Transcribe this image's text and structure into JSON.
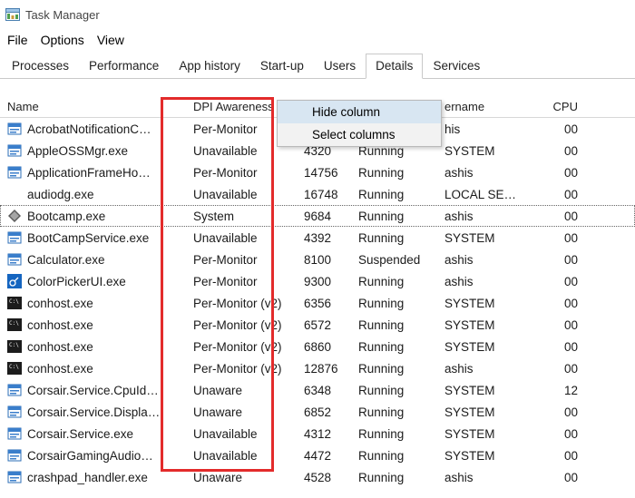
{
  "window": {
    "title": "Task Manager"
  },
  "menu": [
    "File",
    "Options",
    "View"
  ],
  "tabs": [
    "Processes",
    "Performance",
    "App history",
    "Start-up",
    "Users",
    "Details",
    "Services"
  ],
  "active_tab": 5,
  "columns": {
    "name": "Name",
    "dpi": "DPI Awareness",
    "pid": "",
    "status": "",
    "user": "ername",
    "cpu": "CPU"
  },
  "context_menu": {
    "items": [
      "Hide column",
      "Select columns"
    ]
  },
  "rows": [
    {
      "icon": "blue",
      "name": "AcrobatNotificationC…",
      "dpi": "Per-Monitor",
      "pid": "",
      "status": "",
      "user": "his",
      "cpu": "00"
    },
    {
      "icon": "blue",
      "name": "AppleOSSMgr.exe",
      "dpi": "Unavailable",
      "pid": "4320",
      "status": "Running",
      "user": "SYSTEM",
      "cpu": "00"
    },
    {
      "icon": "blue",
      "name": "ApplicationFrameHo…",
      "dpi": "Per-Monitor",
      "pid": "14756",
      "status": "Running",
      "user": "ashis",
      "cpu": "00"
    },
    {
      "icon": "none",
      "name": "audiodg.exe",
      "dpi": "Unavailable",
      "pid": "16748",
      "status": "Running",
      "user": "LOCAL SER…",
      "cpu": "00"
    },
    {
      "icon": "diamond",
      "name": "Bootcamp.exe",
      "dpi": "System",
      "pid": "9684",
      "status": "Running",
      "user": "ashis",
      "cpu": "00",
      "selected": true
    },
    {
      "icon": "blue",
      "name": "BootCampService.exe",
      "dpi": "Unavailable",
      "pid": "4392",
      "status": "Running",
      "user": "SYSTEM",
      "cpu": "00"
    },
    {
      "icon": "blue",
      "name": "Calculator.exe",
      "dpi": "Per-Monitor",
      "pid": "8100",
      "status": "Suspended",
      "user": "ashis",
      "cpu": "00"
    },
    {
      "icon": "picker",
      "name": "ColorPickerUI.exe",
      "dpi": "Per-Monitor",
      "pid": "9300",
      "status": "Running",
      "user": "ashis",
      "cpu": "00"
    },
    {
      "icon": "console",
      "name": "conhost.exe",
      "dpi": "Per-Monitor (v2)",
      "pid": "6356",
      "status": "Running",
      "user": "SYSTEM",
      "cpu": "00"
    },
    {
      "icon": "console",
      "name": "conhost.exe",
      "dpi": "Per-Monitor (v2)",
      "pid": "6572",
      "status": "Running",
      "user": "SYSTEM",
      "cpu": "00"
    },
    {
      "icon": "console",
      "name": "conhost.exe",
      "dpi": "Per-Monitor (v2)",
      "pid": "6860",
      "status": "Running",
      "user": "SYSTEM",
      "cpu": "00"
    },
    {
      "icon": "console",
      "name": "conhost.exe",
      "dpi": "Per-Monitor (v2)",
      "pid": "12876",
      "status": "Running",
      "user": "ashis",
      "cpu": "00"
    },
    {
      "icon": "blue",
      "name": "Corsair.Service.CpuId…",
      "dpi": "Unaware",
      "pid": "6348",
      "status": "Running",
      "user": "SYSTEM",
      "cpu": "12"
    },
    {
      "icon": "blue",
      "name": "Corsair.Service.Displa…",
      "dpi": "Unaware",
      "pid": "6852",
      "status": "Running",
      "user": "SYSTEM",
      "cpu": "00"
    },
    {
      "icon": "blue",
      "name": "Corsair.Service.exe",
      "dpi": "Unavailable",
      "pid": "4312",
      "status": "Running",
      "user": "SYSTEM",
      "cpu": "00"
    },
    {
      "icon": "blue",
      "name": "CorsairGamingAudio…",
      "dpi": "Unavailable",
      "pid": "4472",
      "status": "Running",
      "user": "SYSTEM",
      "cpu": "00"
    },
    {
      "icon": "blue",
      "name": "crashpad_handler.exe",
      "dpi": "Unaware",
      "pid": "4528",
      "status": "Running",
      "user": "ashis",
      "cpu": "00"
    }
  ]
}
